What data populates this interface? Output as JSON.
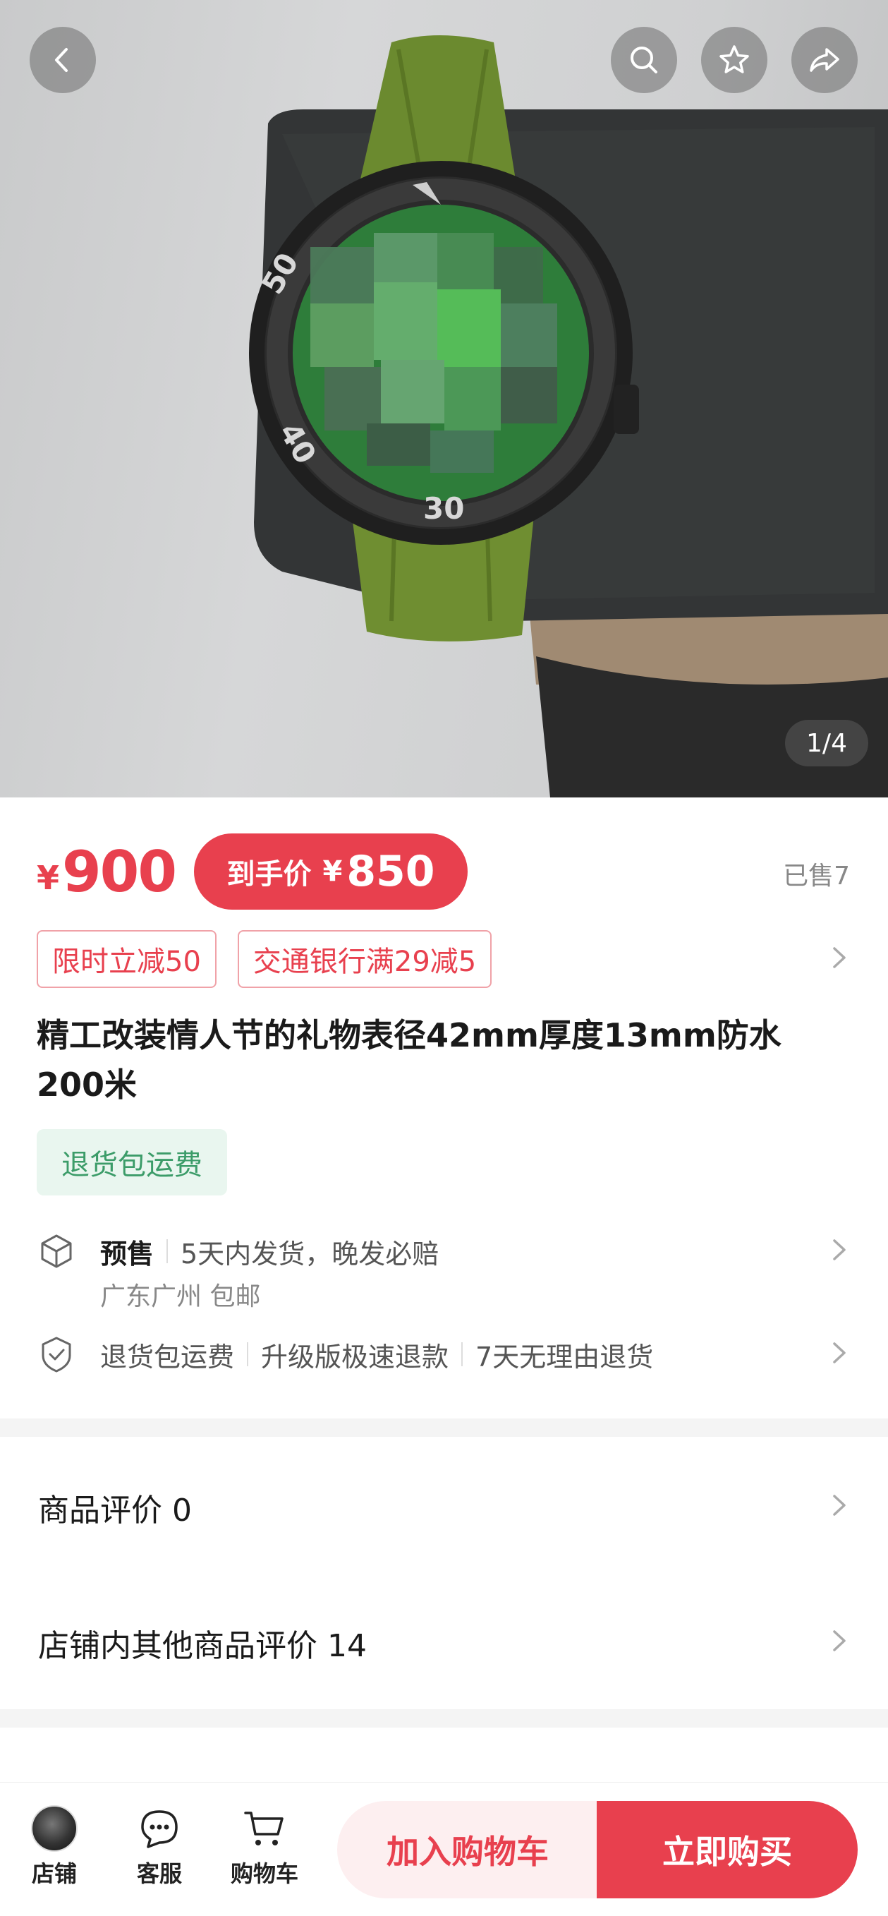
{
  "header": {
    "back_icon": "chevron-left-icon",
    "search_icon": "search-icon",
    "favorite_icon": "star-icon",
    "share_icon": "share-icon",
    "image_counter": "1/4"
  },
  "price": {
    "currency": "¥",
    "original": "900",
    "net_label": "到手价",
    "net_currency": "¥",
    "net_price": "850",
    "sold": "已售7",
    "accent_color": "#e8404e"
  },
  "promotions": [
    "限时立减50",
    "交通银行满29减5"
  ],
  "product": {
    "title": "精工改装情人节的礼物表径42mm厚度13mm防水200米",
    "return_badge": "退货包运费"
  },
  "services": {
    "presale_label": "预售",
    "presale_text": "5天内发货，晚发必赔",
    "shipping_text": "广东广州 包邮",
    "guarantees": [
      "退货包运费",
      "升级版极速退款",
      "7天无理由退货"
    ]
  },
  "reviews": {
    "product_reviews": "商品评价 0",
    "store_reviews": "店铺内其他商品评价 14"
  },
  "bottom_bar": {
    "store": "店铺",
    "service": "客服",
    "cart": "购物车",
    "add_to_cart": "加入购物车",
    "buy_now": "立即购买"
  }
}
